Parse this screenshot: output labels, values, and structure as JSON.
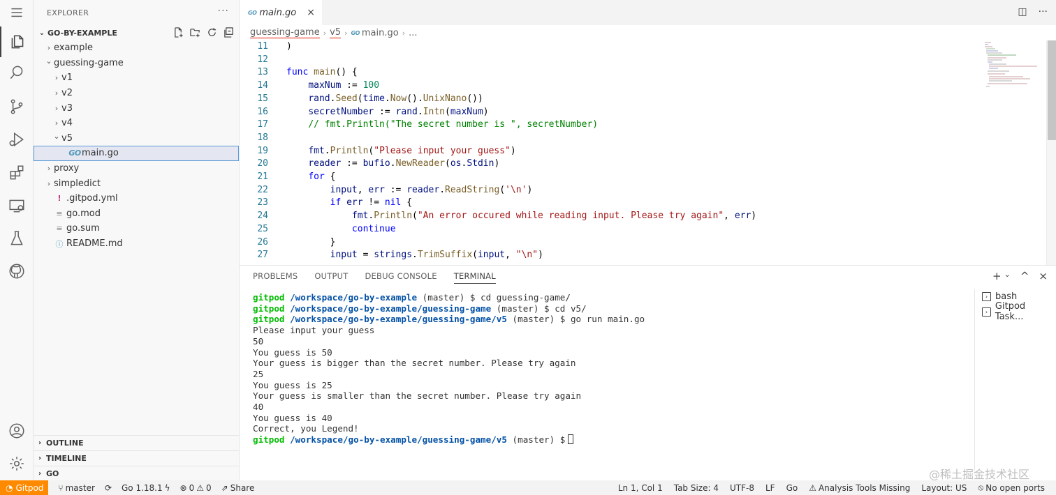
{
  "activity_bar": {
    "items": [
      {
        "icon": "menu-icon"
      },
      {
        "icon": "explorer-icon"
      },
      {
        "icon": "search-icon"
      },
      {
        "icon": "source-control-icon"
      },
      {
        "icon": "run-debug-icon"
      },
      {
        "icon": "extensions-icon"
      },
      {
        "icon": "remote-explorer-icon"
      },
      {
        "icon": "testing-icon"
      },
      {
        "icon": "github-icon"
      },
      {
        "icon": "accounts-icon"
      },
      {
        "icon": "settings-gear-icon"
      }
    ]
  },
  "sidebar": {
    "title": "EXPLORER",
    "more": "···",
    "project": "GO-BY-EXAMPLE",
    "tree": [
      {
        "label": "example",
        "depth": 1,
        "kind": "folder",
        "expanded": false
      },
      {
        "label": "guessing-game",
        "depth": 1,
        "kind": "folder",
        "expanded": true
      },
      {
        "label": "v1",
        "depth": 2,
        "kind": "folder",
        "expanded": false
      },
      {
        "label": "v2",
        "depth": 2,
        "kind": "folder",
        "expanded": false
      },
      {
        "label": "v3",
        "depth": 2,
        "kind": "folder",
        "expanded": false
      },
      {
        "label": "v4",
        "depth": 2,
        "kind": "folder",
        "expanded": false
      },
      {
        "label": "v5",
        "depth": 2,
        "kind": "folder",
        "expanded": true
      },
      {
        "label": "main.go",
        "depth": 3,
        "kind": "go",
        "selected": true
      },
      {
        "label": "proxy",
        "depth": 1,
        "kind": "folder",
        "expanded": false
      },
      {
        "label": "simpledict",
        "depth": 1,
        "kind": "folder",
        "expanded": false
      },
      {
        "label": ".gitpod.yml",
        "depth": 1,
        "kind": "yml"
      },
      {
        "label": "go.mod",
        "depth": 1,
        "kind": "text"
      },
      {
        "label": "go.sum",
        "depth": 1,
        "kind": "text"
      },
      {
        "label": "README.md",
        "depth": 1,
        "kind": "info"
      }
    ],
    "sections": [
      "OUTLINE",
      "TIMELINE",
      "GO"
    ]
  },
  "editor": {
    "tab": {
      "icon_text": "GO",
      "label": "main.go",
      "close": "×"
    },
    "breadcrumb": [
      "guessing-game",
      "v5",
      "main.go",
      "..."
    ],
    "breadcrumb_icon": "GO",
    "lines": [
      {
        "n": "11",
        "tokens": [
          [
            "pl",
            ")"
          ]
        ]
      },
      {
        "n": "12",
        "tokens": []
      },
      {
        "n": "13",
        "tokens": [
          [
            "kw",
            "func "
          ],
          [
            "fn",
            "main"
          ],
          [
            "pl",
            "() {"
          ]
        ]
      },
      {
        "n": "14",
        "tokens": [
          [
            "pl",
            "    "
          ],
          [
            "var",
            "maxNum"
          ],
          [
            "pl",
            " := "
          ],
          [
            "num",
            "100"
          ]
        ]
      },
      {
        "n": "15",
        "tokens": [
          [
            "pl",
            "    "
          ],
          [
            "var",
            "rand"
          ],
          [
            "pl",
            "."
          ],
          [
            "fcall",
            "Seed"
          ],
          [
            "pl",
            "("
          ],
          [
            "var",
            "time"
          ],
          [
            "pl",
            "."
          ],
          [
            "fcall",
            "Now"
          ],
          [
            "pl",
            "()."
          ],
          [
            "fcall",
            "UnixNano"
          ],
          [
            "pl",
            "())"
          ]
        ]
      },
      {
        "n": "16",
        "tokens": [
          [
            "pl",
            "    "
          ],
          [
            "var",
            "secretNumber"
          ],
          [
            "pl",
            " := "
          ],
          [
            "var",
            "rand"
          ],
          [
            "pl",
            "."
          ],
          [
            "fcall",
            "Intn"
          ],
          [
            "pl",
            "("
          ],
          [
            "var",
            "maxNum"
          ],
          [
            "pl",
            ")"
          ]
        ]
      },
      {
        "n": "17",
        "tokens": [
          [
            "pl",
            "    "
          ],
          [
            "cm",
            "// fmt.Println(\"The secret number is \", secretNumber)"
          ]
        ]
      },
      {
        "n": "18",
        "tokens": []
      },
      {
        "n": "19",
        "tokens": [
          [
            "pl",
            "    "
          ],
          [
            "var",
            "fmt"
          ],
          [
            "pl",
            "."
          ],
          [
            "fcall",
            "Println"
          ],
          [
            "pl",
            "("
          ],
          [
            "str",
            "\"Please input your guess\""
          ],
          [
            "pl",
            ")"
          ]
        ]
      },
      {
        "n": "20",
        "tokens": [
          [
            "pl",
            "    "
          ],
          [
            "var",
            "reader"
          ],
          [
            "pl",
            " := "
          ],
          [
            "var",
            "bufio"
          ],
          [
            "pl",
            "."
          ],
          [
            "fcall",
            "NewReader"
          ],
          [
            "pl",
            "("
          ],
          [
            "var",
            "os"
          ],
          [
            "pl",
            "."
          ],
          [
            "var",
            "Stdin"
          ],
          [
            "pl",
            ")"
          ]
        ]
      },
      {
        "n": "21",
        "tokens": [
          [
            "pl",
            "    "
          ],
          [
            "kw",
            "for"
          ],
          [
            "pl",
            " {"
          ]
        ]
      },
      {
        "n": "22",
        "tokens": [
          [
            "pl",
            "        "
          ],
          [
            "var",
            "input"
          ],
          [
            "pl",
            ", "
          ],
          [
            "var",
            "err"
          ],
          [
            "pl",
            " := "
          ],
          [
            "var",
            "reader"
          ],
          [
            "pl",
            "."
          ],
          [
            "fcall",
            "ReadString"
          ],
          [
            "pl",
            "("
          ],
          [
            "str",
            "'\\n'"
          ],
          [
            "pl",
            ")"
          ]
        ]
      },
      {
        "n": "23",
        "tokens": [
          [
            "pl",
            "        "
          ],
          [
            "kw",
            "if "
          ],
          [
            "var",
            "err"
          ],
          [
            "pl",
            " != "
          ],
          [
            "kw",
            "nil"
          ],
          [
            "pl",
            " {"
          ]
        ]
      },
      {
        "n": "24",
        "tokens": [
          [
            "pl",
            "            "
          ],
          [
            "var",
            "fmt"
          ],
          [
            "pl",
            "."
          ],
          [
            "fcall",
            "Println"
          ],
          [
            "pl",
            "("
          ],
          [
            "str",
            "\"An error occured while reading input. Please try again\""
          ],
          [
            "pl",
            ", "
          ],
          [
            "var",
            "err"
          ],
          [
            "pl",
            ")"
          ]
        ]
      },
      {
        "n": "25",
        "tokens": [
          [
            "pl",
            "            "
          ],
          [
            "kw",
            "continue"
          ]
        ]
      },
      {
        "n": "26",
        "tokens": [
          [
            "pl",
            "        }"
          ]
        ]
      },
      {
        "n": "27",
        "tokens": [
          [
            "pl",
            "        "
          ],
          [
            "var",
            "input"
          ],
          [
            "pl",
            " = "
          ],
          [
            "var",
            "strings"
          ],
          [
            "pl",
            "."
          ],
          [
            "fcall",
            "TrimSuffix"
          ],
          [
            "pl",
            "("
          ],
          [
            "var",
            "input"
          ],
          [
            "pl",
            ", "
          ],
          [
            "str",
            "\"\\n\""
          ],
          [
            "pl",
            ")"
          ]
        ]
      }
    ]
  },
  "panel": {
    "tabs": [
      "PROBLEMS",
      "OUTPUT",
      "DEBUG CONSOLE",
      "TERMINAL"
    ],
    "active_tab": "TERMINAL",
    "actions": {
      "new": "+",
      "dropdown": "⌄",
      "maximize": "^",
      "close": "×"
    },
    "terminal_lines": [
      {
        "user": "gitpod",
        "path": "/workspace/go-by-example",
        "rest": " (master) $ cd guessing-game/"
      },
      {
        "user": "gitpod",
        "path": "/workspace/go-by-example/guessing-game",
        "rest": " (master) $ cd v5/"
      },
      {
        "user": "gitpod",
        "path": "/workspace/go-by-example/guessing-game/v5",
        "rest": " (master) $ go run main.go"
      },
      {
        "text": "Please input your guess"
      },
      {
        "text": "50"
      },
      {
        "text": "You guess is 50"
      },
      {
        "text": "Your guess is bigger than the secret number. Please try again"
      },
      {
        "text": "25"
      },
      {
        "text": "You guess is 25"
      },
      {
        "text": "Your guess is smaller than the secret number. Please try again"
      },
      {
        "text": "40"
      },
      {
        "text": "You guess is 40"
      },
      {
        "text": "Correct, you Legend!"
      },
      {
        "user": "gitpod",
        "path": "/workspace/go-by-example/guessing-game/v5",
        "rest": " (master) $",
        "cursor": true
      }
    ],
    "terminal_instances": [
      "bash",
      "Gitpod Task..."
    ]
  },
  "status_bar": {
    "gitpod": "Gitpod",
    "branch": "master",
    "go_version": "Go 1.18.1",
    "errors": "0",
    "warnings": "0",
    "share": "Share",
    "position": "Ln 1, Col 1",
    "tab_size": "Tab Size: 4",
    "encoding": "UTF-8",
    "eol": "LF",
    "language": "Go",
    "analysis": "Analysis Tools Missing",
    "layout": "Layout: US",
    "ports": "No open ports"
  },
  "watermark": "@稀土掘金技术社区",
  "colors": {
    "gitpod_orange": "#ff8a00",
    "terminal_user": "#00bc00",
    "terminal_path": "#0451a5",
    "keyword": "#0000ff",
    "string": "#a31515",
    "comment": "#008000",
    "number": "#098658"
  }
}
